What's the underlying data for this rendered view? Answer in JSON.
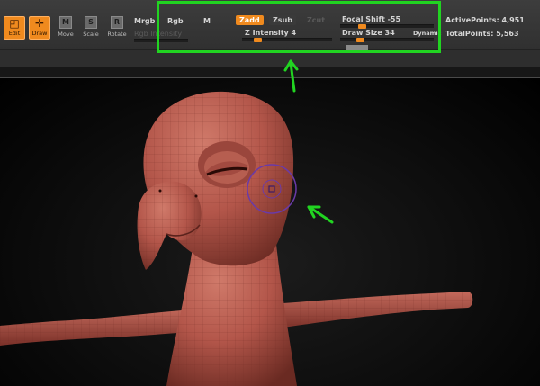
{
  "tools": {
    "edit": "Edit",
    "draw": "Draw",
    "move": "Move",
    "scale": "Scale",
    "rotate": "Rotate"
  },
  "color_modes": {
    "mrgb": "Mrgb",
    "rgb": "Rgb",
    "m": "M",
    "rgb_intensity": "Rgb Intensity"
  },
  "sculpt_modes": {
    "zadd": "Zadd",
    "zsub": "Zsub",
    "zcut": "Zcut"
  },
  "z_intensity": {
    "label": "Z Intensity 4",
    "level": 0.04
  },
  "focal_shift": {
    "label": "Focal Shift -55",
    "level": 0.22
  },
  "draw_size": {
    "label": "Draw Size 34",
    "level": 0.12
  },
  "dynamic_label": "Dynamic",
  "stats": {
    "active_points": "ActivePoints: 4,951",
    "total_points": "TotalPoints: 5,563"
  },
  "colors": {
    "accent": "#f08a1e",
    "highlight_box": "#21d421",
    "model": "#b3564a",
    "brush_cursor": "#6a3aa8"
  }
}
